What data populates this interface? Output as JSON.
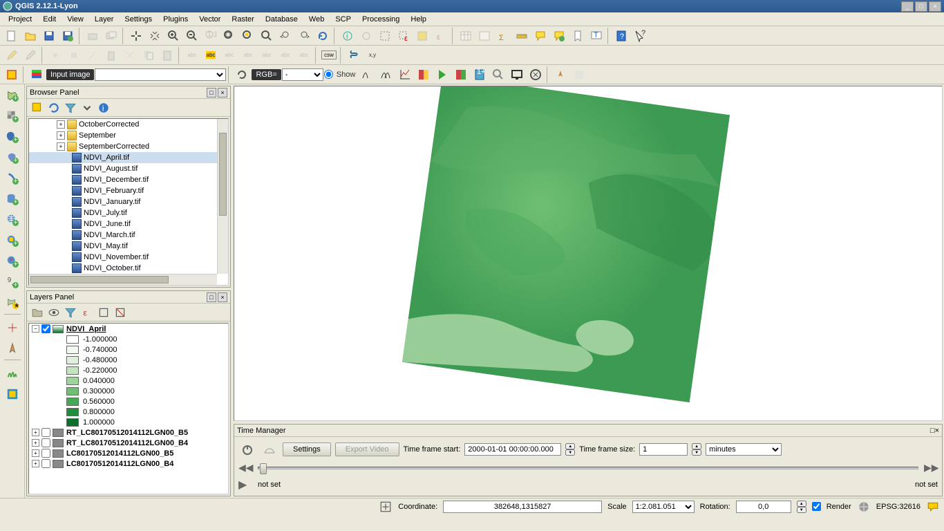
{
  "app": {
    "title": "QGIS 2.12.1-Lyon"
  },
  "menu": [
    "Project",
    "Edit",
    "View",
    "Layer",
    "Settings",
    "Plugins",
    "Vector",
    "Raster",
    "Database",
    "Web",
    "SCP",
    "Processing",
    "Help"
  ],
  "scp": {
    "input_label": "Input image",
    "rgb_label": "RGB=",
    "rgb_value": "-",
    "show_label": "Show"
  },
  "browser": {
    "title": "Browser Panel",
    "folders": [
      "OctoberCorrected",
      "September",
      "SeptemberCorrected"
    ],
    "files": [
      "NDVI_April.tif",
      "NDVI_August.tif",
      "NDVI_December.tif",
      "NDVI_February.tif",
      "NDVI_January.tif",
      "NDVI_July.tif",
      "NDVI_June.tif",
      "NDVI_March.tif",
      "NDVI_May.tif",
      "NDVI_November.tif",
      "NDVI_October.tif"
    ],
    "selected": "NDVI_April.tif"
  },
  "layers": {
    "title": "Layers Panel",
    "active": {
      "name": "NDVI_April",
      "legend": [
        {
          "v": "-1.000000",
          "c": "#ffffff"
        },
        {
          "v": "-0.740000",
          "c": "#f2f9f1"
        },
        {
          "v": "-0.480000",
          "c": "#dff0dc"
        },
        {
          "v": "-0.220000",
          "c": "#c3e4be"
        },
        {
          "v": "0.040000",
          "c": "#9ed499"
        },
        {
          "v": "0.300000",
          "c": "#6fbf73"
        },
        {
          "v": "0.560000",
          "c": "#45a856"
        },
        {
          "v": "0.800000",
          "c": "#228c3e"
        },
        {
          "v": "1.000000",
          "c": "#08702c"
        }
      ]
    },
    "others": [
      "RT_LC80170512014112LGN00_B5",
      "RT_LC80170512014112LGN00_B4",
      "LC80170512014112LGN00_B5",
      "LC80170512014112LGN00_B4"
    ]
  },
  "time": {
    "title": "Time Manager",
    "settings": "Settings",
    "export": "Export Video",
    "frame_start_label": "Time frame start:",
    "frame_start_value": "2000-01-01 00:00:00.000",
    "frame_size_label": "Time frame size:",
    "frame_size_value": "1",
    "unit": "minutes",
    "notset": "not set"
  },
  "status": {
    "coordinate_label": "Coordinate:",
    "coordinate_value": "382648,1315827",
    "scale_label": "Scale",
    "scale_value": "1:2.081.051",
    "rotation_label": "Rotation:",
    "rotation_value": "0,0",
    "render_label": "Render",
    "crs": "EPSG:32616"
  }
}
